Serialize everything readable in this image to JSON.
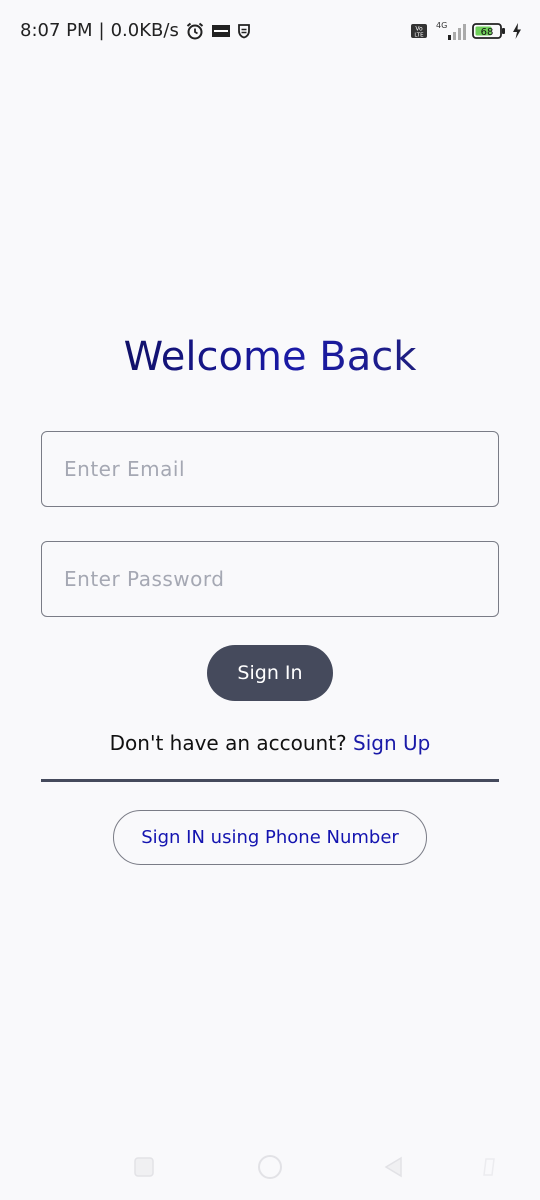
{
  "status_bar": {
    "time": "8:07 PM",
    "speed": "0.0KB/s",
    "network": "4G",
    "battery": "68",
    "icons": [
      "alarm-icon",
      "app-notification-icon",
      "shield-icon",
      "volte-icon",
      "signal-icon",
      "battery-icon",
      "charging-icon"
    ]
  },
  "login": {
    "title": "Welcome Back",
    "email_placeholder": "Enter Email",
    "password_placeholder": "Enter Password",
    "signin_label": "Sign In",
    "no_account_text": "Don't have an account?",
    "signup_link": "Sign Up",
    "phone_signin_label": "Sign IN using Phone Number"
  },
  "nav_bar": {
    "icons": [
      "recent-apps-icon",
      "home-icon",
      "back-icon",
      "accessibility-icon"
    ]
  },
  "colors": {
    "background": "#f9f9fb",
    "title": "#1a1aa8",
    "button_bg": "#454a5c",
    "link": "#1a1aa8",
    "border": "#7a7c86"
  }
}
